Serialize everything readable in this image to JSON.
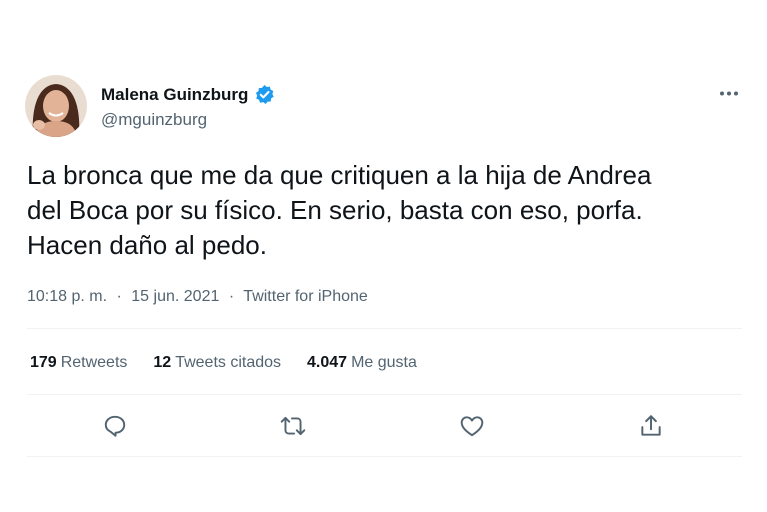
{
  "author": {
    "display_name": "Malena Guinzburg",
    "handle": "@mguinzburg",
    "verified": true
  },
  "tweet": {
    "lines": [
      "La bronca que me da que critiquen a la hija de Andrea",
      "del Boca por su físico. En serio, basta con eso, porfa.",
      "Hacen daño al pedo."
    ]
  },
  "meta": {
    "time": "10:18 p. m.",
    "separator": "·",
    "date": "15 jun. 2021",
    "source": "Twitter for iPhone"
  },
  "stats": {
    "retweets_count": "179",
    "retweets_label": "Retweets",
    "quotes_count": "12",
    "quotes_label": "Tweets citados",
    "likes_count": "4.047",
    "likes_label": "Me gusta"
  },
  "actions": [
    "reply-icon",
    "retweet-icon",
    "like-icon",
    "share-icon"
  ],
  "colors": {
    "text": "#0f1419",
    "secondary": "#536471",
    "verified": "#1d9bf0",
    "divider": "#eff3f4"
  }
}
